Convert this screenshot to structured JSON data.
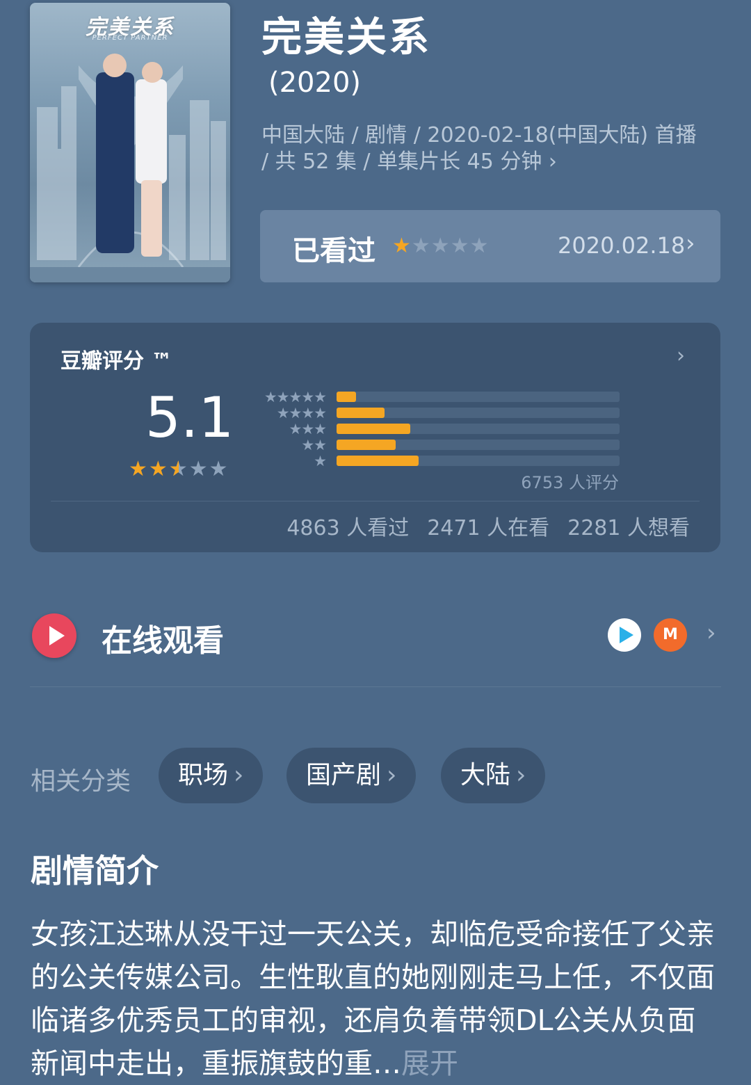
{
  "poster": {
    "title": "完美关系",
    "subtitle": "PERFECT PARTNER"
  },
  "header": {
    "title": "完美关系",
    "year": "(2020)",
    "meta_line": "中国大陆 / 剧情 / 2020-02-18(中国大陆) 首播 / 共 52 集 / 单集片长 45 分钟",
    "meta_chevron": "›"
  },
  "seen": {
    "label": "已看过",
    "user_rating_stars": 1,
    "stars_on": "★",
    "stars_off": "★★★★",
    "date": "2020.02.18",
    "chevron": "›"
  },
  "rating": {
    "title": "豆瓣评分 ™",
    "score": "5.1",
    "score_stars": 2.5,
    "distribution": [
      {
        "stars": "★★★★★",
        "fraction": 0.07
      },
      {
        "stars": "★★★★",
        "fraction": 0.17
      },
      {
        "stars": "★★★",
        "fraction": 0.26
      },
      {
        "stars": "★★",
        "fraction": 0.21
      },
      {
        "stars": "★",
        "fraction": 0.29
      }
    ],
    "count": "6753 人评分",
    "watched": "4863 人看过",
    "watching": "2471 人在看",
    "want": "2281 人想看",
    "chevron": "›"
  },
  "online": {
    "label": "在线观看",
    "mg_glyph": "M",
    "chevron": "›"
  },
  "related": {
    "label": "相关分类",
    "tags": [
      "职场",
      "国产剧",
      "大陆"
    ],
    "chevron": "›"
  },
  "synopsis": {
    "title": "剧情简介",
    "text": "女孩江达琳从没干过一天公关，却临危受命接任了父亲的公关传媒公司。生性耿直的她刚刚走马上任，不仅面临诸多优秀员工的审视，还肩负着带领DL公关从负面新闻中走出，重振旗鼓的重",
    "expand": "展开"
  },
  "colors": {
    "accent": "#f5a623",
    "background": "#4c6989",
    "card": "#3c5470",
    "play": "#e8475d"
  }
}
